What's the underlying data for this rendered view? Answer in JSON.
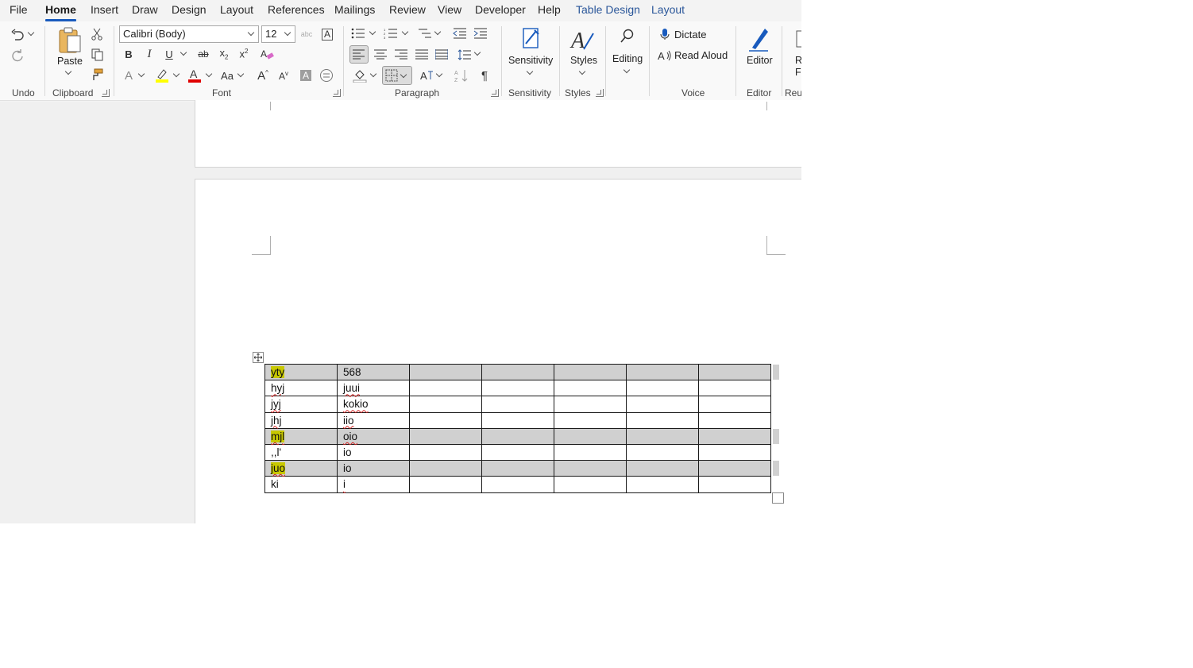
{
  "menu": {
    "tabs": [
      {
        "label": "File",
        "active": false,
        "contextual": false
      },
      {
        "label": "Home",
        "active": true,
        "contextual": false
      },
      {
        "label": "Insert",
        "active": false,
        "contextual": false
      },
      {
        "label": "Draw",
        "active": false,
        "contextual": false
      },
      {
        "label": "Design",
        "active": false,
        "contextual": false
      },
      {
        "label": "Layout",
        "active": false,
        "contextual": false
      },
      {
        "label": "References",
        "active": false,
        "contextual": false
      },
      {
        "label": "Mailings",
        "active": false,
        "contextual": false
      },
      {
        "label": "Review",
        "active": false,
        "contextual": false
      },
      {
        "label": "View",
        "active": false,
        "contextual": false
      },
      {
        "label": "Developer",
        "active": false,
        "contextual": false
      },
      {
        "label": "Help",
        "active": false,
        "contextual": false
      },
      {
        "label": "Table Design",
        "active": false,
        "contextual": true
      },
      {
        "label": "Layout",
        "active": false,
        "contextual": true
      }
    ]
  },
  "ribbon": {
    "groups": {
      "undo": "Undo",
      "clipboard": "Clipboard",
      "font": "Font",
      "paragraph": "Paragraph",
      "sensitivity": "Sensitivity",
      "styles": "Styles",
      "voice": "Voice",
      "editor": "Editor",
      "reuse": "Reu"
    },
    "clipboard": {
      "paste_label": "Paste"
    },
    "font": {
      "font_name": "Calibri (Body)",
      "font_size": "12",
      "bold": "B",
      "italic": "I",
      "underline": "U",
      "strikethrough": "ab",
      "subscript": "x",
      "superscript": "x",
      "grow": "A",
      "shrink": "A",
      "change_case": "Aa",
      "text_effects": "A",
      "font_color": "A",
      "highlight_color": "#ffff00",
      "font_color_value": "#e00000"
    },
    "paragraph": {
      "pilcrow": "¶"
    },
    "sensitivity_label": "Sensitivity",
    "styles_label": "Styles",
    "editing_label": "Editing",
    "voice": {
      "dictate": "Dictate",
      "read_aloud": "Read Aloud"
    },
    "editor_label": "Editor",
    "reuse_partial": "R\nF"
  },
  "document": {
    "table": {
      "rows": [
        {
          "cells": [
            "yty",
            "568",
            "",
            "",
            "",
            "",
            ""
          ],
          "shaded": true,
          "highlight_first": true,
          "squiggle": [
            false,
            false
          ]
        },
        {
          "cells": [
            "hyj",
            "juui",
            "",
            "",
            "",
            "",
            ""
          ],
          "shaded": false,
          "highlight_first": false,
          "squiggle": [
            true,
            true
          ]
        },
        {
          "cells": [
            "jyj",
            "kokio",
            "",
            "",
            "",
            "",
            ""
          ],
          "shaded": false,
          "highlight_first": false,
          "squiggle": [
            true,
            true
          ]
        },
        {
          "cells": [
            "jhj",
            "iio",
            "",
            "",
            "",
            "",
            ""
          ],
          "shaded": false,
          "highlight_first": false,
          "squiggle": [
            true,
            true
          ]
        },
        {
          "cells": [
            "mjl",
            "oio",
            "",
            "",
            "",
            "",
            ""
          ],
          "shaded": true,
          "highlight_first": true,
          "squiggle": [
            true,
            true
          ]
        },
        {
          "cells": [
            ",,l'",
            "io",
            "",
            "",
            "",
            "",
            ""
          ],
          "shaded": false,
          "highlight_first": false,
          "squiggle": [
            false,
            false
          ]
        },
        {
          "cells": [
            "juo",
            "io",
            "",
            "",
            "",
            "",
            ""
          ],
          "shaded": true,
          "highlight_first": true,
          "squiggle": [
            true,
            false
          ]
        },
        {
          "cells": [
            "ki",
            "i",
            "",
            "",
            "",
            "",
            ""
          ],
          "shaded": false,
          "highlight_first": false,
          "squiggle": [
            false,
            true
          ]
        }
      ]
    }
  }
}
